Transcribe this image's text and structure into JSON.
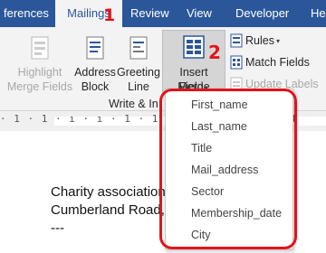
{
  "tabs": [
    {
      "label": "ferences",
      "active": false
    },
    {
      "label": "Mailings",
      "active": true
    },
    {
      "label": "Review",
      "active": false
    },
    {
      "label": "View",
      "active": false
    },
    {
      "label": "Developer",
      "active": false
    },
    {
      "label": "Hel",
      "active": false
    }
  ],
  "annotations": {
    "tab_marker": "1",
    "button_marker": "2"
  },
  "ribbon": {
    "highlight_merge_fields": {
      "line1": "Highlight",
      "line2": "Merge Fields",
      "enabled": false
    },
    "address_block": {
      "line1": "Address",
      "line2": "Block",
      "enabled": true
    },
    "greeting_line": {
      "line1": "Greeting",
      "line2": "Line",
      "enabled": true
    },
    "insert_merge_field": {
      "line1": "Insert Merge",
      "line2": "Field",
      "enabled": true,
      "pressed": true
    },
    "rules": {
      "label": "Rules",
      "enabled": true
    },
    "match_fields": {
      "label": "Match Fields",
      "enabled": true
    },
    "update_labels": {
      "label": "Update Labels",
      "enabled": false
    },
    "group_label": "Write & In"
  },
  "ruler": {
    "text": "· 1 · 1 · ı · ı · 1 · 1 · 2 · 1 · 3 · 1 · 4"
  },
  "document": {
    "lines": [
      "Charity association",
      "Cumberland Road,",
      "---"
    ]
  },
  "dropdown": {
    "items": [
      "First_name",
      "Last_name",
      "Title",
      "Mail_address",
      "Sector",
      "Membership_date",
      "City"
    ]
  },
  "colors": {
    "tabbar": "#2b579a",
    "ribbon": "#f3f3f3",
    "highlight_red": "#e3131b",
    "icon_blue": "#2b579a",
    "disabled": "#a8a8a8"
  }
}
